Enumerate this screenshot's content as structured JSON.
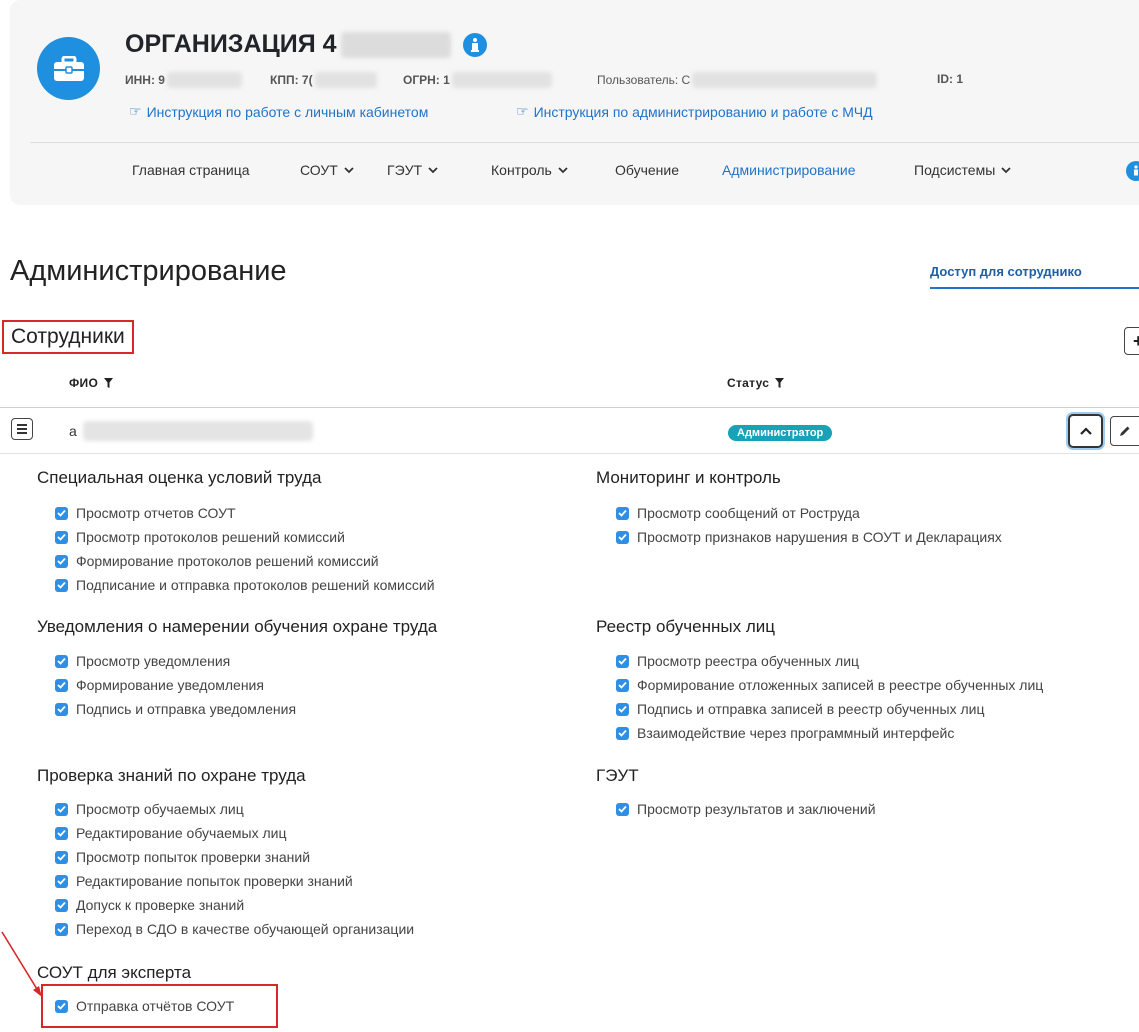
{
  "header": {
    "org_name": "ОРГАНИЗАЦИЯ 4",
    "inn_label": "ИНН: 9",
    "kpp_label": "КПП: 7(",
    "ogrn_label": "ОГРН: 1",
    "user_label": "Пользователь: С",
    "id_label": "ID: 1",
    "link_cabinet": "Инструкция по работе с личным кабинетом",
    "link_admin": "Инструкция по администрированию и работе с МЧД",
    "icon_org": "briefcase-icon",
    "icon_info": "info-icon",
    "icon_link": "hand-pointer-icon"
  },
  "nav": {
    "items": [
      "Главная страница",
      "СОУТ",
      "ГЭУТ",
      "Контроль",
      "Обучение",
      "Администрирование",
      "Подсистемы"
    ],
    "active": "Администрирование"
  },
  "page": {
    "title": "Администрирование",
    "access_link": "Доступ для сотруднико"
  },
  "employees": {
    "section_title": "Сотрудники",
    "add_label": "+",
    "col_fio": "ФИО",
    "col_status": "Статус",
    "row": {
      "name_initial": "а",
      "status": "Администратор"
    }
  },
  "permissions": {
    "sout": {
      "title": "Специальная оценка условий труда",
      "items": [
        "Просмотр отчетов СОУТ",
        "Просмотр протоколов решений комиссий",
        "Формирование протоколов решений комиссий",
        "Подписание и отправка протоколов решений комиссий"
      ]
    },
    "monitoring": {
      "title": "Мониторинг и контроль",
      "items": [
        "Просмотр сообщений от Роструда",
        "Просмотр признаков нарушения в СОУТ и Декларациях"
      ]
    },
    "notifications": {
      "title": "Уведомления о намерении обучения охране труда",
      "items": [
        "Просмотр уведомления",
        "Формирование уведомления",
        "Подпись и отправка уведомления"
      ]
    },
    "registry": {
      "title": "Реестр обученных лиц",
      "items": [
        "Просмотр реестра обученных лиц",
        "Формирование отложенных записей в реестре обученных лиц",
        "Подпись и отправка записей в реестр обученных лиц",
        "Взаимодействие через программный интерфейс"
      ]
    },
    "knowledge": {
      "title": "Проверка знаний по охране труда",
      "items": [
        "Просмотр обучаемых лиц",
        "Редактирование обучаемых лиц",
        "Просмотр попыток проверки знаний",
        "Редактирование попыток проверки знаний",
        "Допуск к проверке знаний",
        "Переход в СДО в качестве обучающей организации"
      ]
    },
    "geut": {
      "title": "ГЭУТ",
      "items": [
        "Просмотр результатов и заключений"
      ]
    },
    "expert": {
      "title": "СОУТ для эксперта",
      "items": [
        "Отправка отчётов СОУТ"
      ]
    }
  },
  "colors": {
    "accent": "#1f8fe0",
    "link": "#1f74c9",
    "badge": "#17a2b8",
    "highlight": "#d62828"
  }
}
